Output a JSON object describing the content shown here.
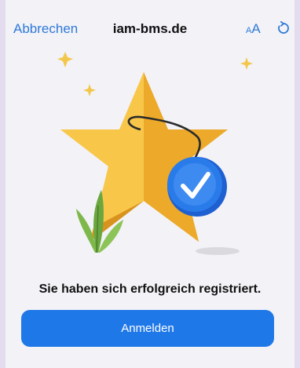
{
  "header": {
    "cancel_label": "Abbrechen",
    "site_title": "iam-bms.de",
    "text_size_small": "A",
    "text_size_large": "A"
  },
  "main": {
    "success_message": "Sie haben sich erfolgreich registriert.",
    "login_label": "Anmelden"
  },
  "colors": {
    "accent": "#2f79d8",
    "button": "#1f78e8",
    "star": "#f5b731",
    "badge": "#2a7bea",
    "background": "#f2f2f7"
  },
  "icons": [
    "reload-icon",
    "star-illustration",
    "checkmark-badge-icon",
    "sparkle-icon",
    "plant-icon"
  ]
}
